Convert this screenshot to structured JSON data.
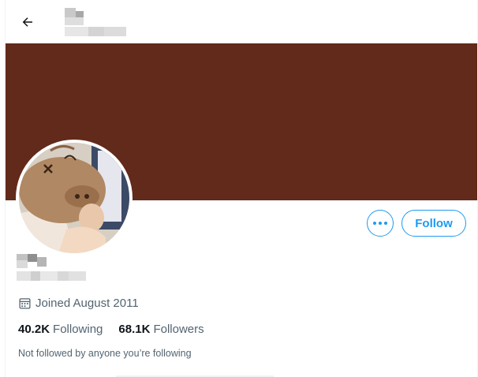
{
  "header": {
    "back_icon": "arrow-left-icon"
  },
  "banner": {
    "color": "#622a1a"
  },
  "profile": {
    "avatar_icon": "pig-cartoon-avatar",
    "more_button_icon": "ellipsis-icon",
    "follow_label": "Follow",
    "joined_icon": "calendar-icon",
    "joined_text": "Joined August 2011",
    "following_count": "40.2K",
    "following_label": "Following",
    "followers_count": "68.1K",
    "followers_label": "Followers",
    "not_followed_text": "Not followed by anyone you’re following"
  },
  "colors": {
    "accent": "#1d9bf0",
    "secondary_text": "#536471",
    "primary_text": "#0f1419"
  }
}
